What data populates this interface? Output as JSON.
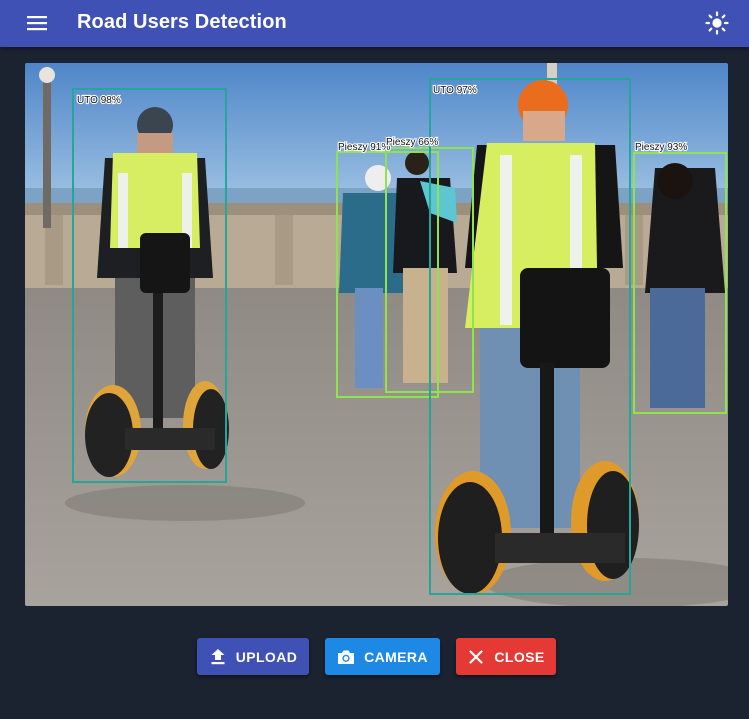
{
  "app": {
    "title": "Road Users Detection"
  },
  "icons": {
    "menu": "menu-icon",
    "theme": "sun-icon",
    "upload": "upload-icon",
    "camera": "camera-icon",
    "close": "close-icon"
  },
  "colors": {
    "appbar": "#3f51b5",
    "background": "#1b2230",
    "upload_button": "#3f51b5",
    "camera_button": "#1e88e5",
    "close_button": "#e53935",
    "box_uto": "#26a69a",
    "box_pieszy": "#8ee34f"
  },
  "detections": [
    {
      "label": "UTO 98%",
      "class": "UTO"
    },
    {
      "label": "Pieszy 91%",
      "class": "Pieszy"
    },
    {
      "label": "Pieszy 66%",
      "class": "Pieszy"
    },
    {
      "label": "UTO 97%",
      "class": "UTO"
    },
    {
      "label": "Pieszy 93%",
      "class": "Pieszy"
    }
  ],
  "actions": {
    "upload_label": "UPLOAD",
    "camera_label": "CAMERA",
    "close_label": "CLOSE"
  }
}
